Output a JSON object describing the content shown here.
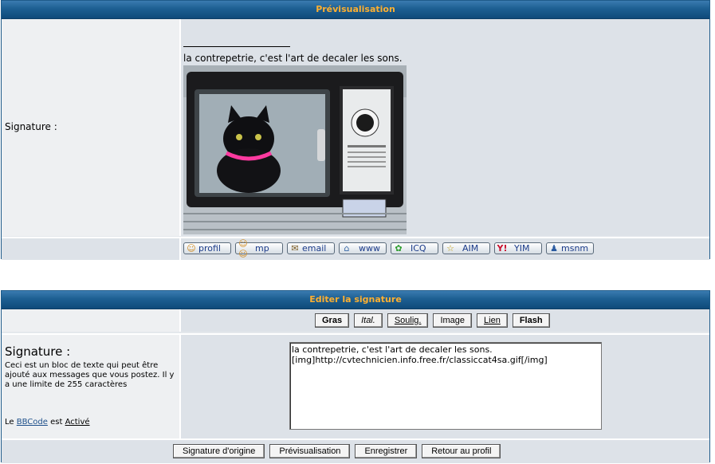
{
  "preview_panel": {
    "title": "Prévisualisation",
    "signature_label": "Signature :",
    "signature_text": "la contrepetrie, c'est l'art de decaler les sons.",
    "contact_buttons": [
      {
        "label": "profil",
        "icon": "profile-icon"
      },
      {
        "label": "mp",
        "icon": "private-message-icon"
      },
      {
        "label": "email",
        "icon": "email-icon"
      },
      {
        "label": "www",
        "icon": "website-icon"
      },
      {
        "label": "ICQ",
        "icon": "icq-icon"
      },
      {
        "label": "AIM",
        "icon": "aim-icon"
      },
      {
        "label": "YIM",
        "icon": "yahoo-icon"
      },
      {
        "label": "msnm",
        "icon": "msn-icon"
      }
    ]
  },
  "edit_panel": {
    "title": "Editer la signature",
    "format_buttons": {
      "bold": "Gras",
      "italic": "Ital.",
      "underline": "Soulig.",
      "image": "Image",
      "link": "Lien",
      "flash": "Flash"
    },
    "field_title": "Signature :",
    "field_description": "Ceci est un bloc de texte qui peut être ajouté aux messages que vous postez. Il y a une limite de 255 caractères",
    "bbcode_prefix": "Le",
    "bbcode_link": "BBCode",
    "bbcode_middle": "est",
    "bbcode_status": "Activé",
    "textarea_value": "la contrepetrie, c'est l'art de decaler les sons.\n[img]http://cvtechnicien.info.free.fr/classiccat4sa.gif[/img]",
    "actions": {
      "original": "Signature d'origine",
      "preview": "Prévisualisation",
      "save": "Enregistrer",
      "back": "Retour au profil"
    }
  },
  "colors": {
    "header_text": "#ffb030",
    "header_bg": "#1d5f92",
    "panel_bg": "#dde2e8"
  }
}
